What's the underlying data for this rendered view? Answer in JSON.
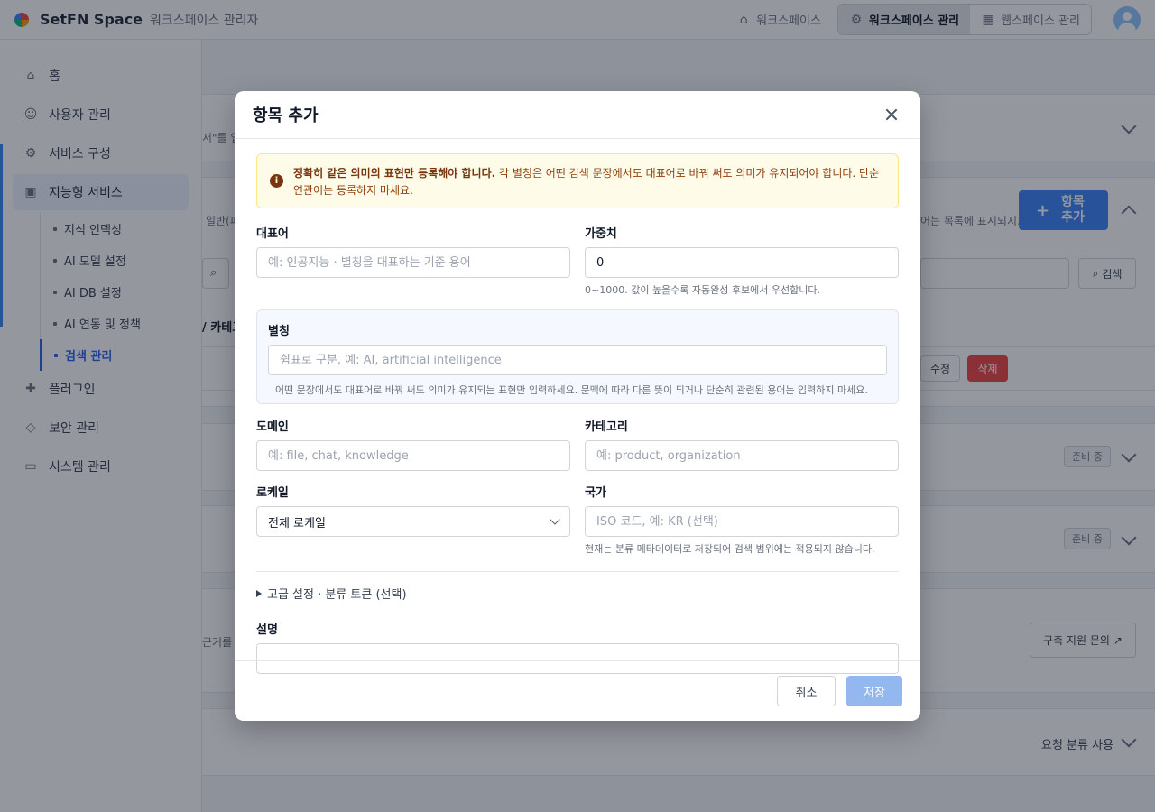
{
  "header": {
    "brand": "SetFN Space",
    "subtitle": "워크스페이스 관리자",
    "nav_workspace": "워크스페이스",
    "nav_workspace_admin": "워크스페이스 관리",
    "nav_webspace_admin": "웹스페이스 관리"
  },
  "sidebar": {
    "items": [
      {
        "label": "홈",
        "icon": "home-icon"
      },
      {
        "label": "사용자 관리",
        "icon": "users-icon"
      },
      {
        "label": "서비스 구성",
        "icon": "gear-icon"
      },
      {
        "label": "지능형 서비스",
        "icon": "chip-icon"
      },
      {
        "label": "플러그인",
        "icon": "puzzle-icon"
      },
      {
        "label": "보안 관리",
        "icon": "shield-icon"
      },
      {
        "label": "시스템 관리",
        "icon": "monitor-icon"
      }
    ],
    "sub_items": [
      {
        "label": "지식 인덱싱"
      },
      {
        "label": "AI 모델 설정"
      },
      {
        "label": "AI DB 설정"
      },
      {
        "label": "AI 연동 및 정책"
      },
      {
        "label": "검색 관리"
      }
    ]
  },
  "background": {
    "text1": "서\"를 입",
    "text2": "일반(파",
    "text3": "어는 목록에 표시되지...",
    "add_item_button": "항목 추가",
    "search_button": "검색",
    "category_text": "/ 카테고",
    "edit_button": "수정",
    "delete_button": "삭제",
    "badge_pending": "준비 중",
    "text4": "근거를 찾",
    "support_button": "구축 지원 문의",
    "request_text": "요청 분류 사용"
  },
  "modal": {
    "title": "항목 추가",
    "warning_bold": "정확히 같은 의미의 표현만 등록해야 합니다.",
    "warning_text": " 각 별칭은 어떤 검색 문장에서도 대표어로 바꿔 써도 의미가 유지되어야 합니다. 단순 연관어는 등록하지 마세요.",
    "rep_label": "대표어",
    "rep_placeholder": "예: 인공지능 · 별칭을 대표하는 기준 용어",
    "weight_label": "가중치",
    "weight_value": "0",
    "weight_hint": "0~1000. 값이 높을수록 자동완성 후보에서 우선합니다.",
    "alias_label": "별칭",
    "alias_placeholder": "쉼표로 구분, 예: AI, artificial intelligence",
    "alias_hint": "어떤 문장에서도 대표어로 바꿔 써도 의미가 유지되는 표현만 입력하세요. 문맥에 따라 다른 뜻이 되거나 단순히 관련된 용어는 입력하지 마세요.",
    "domain_label": "도메인",
    "domain_placeholder": "예: file, chat, knowledge",
    "category_label": "카테고리",
    "category_placeholder": "예: product, organization",
    "locale_label": "로케일",
    "locale_value": "전체 로케일",
    "country_label": "국가",
    "country_placeholder": "ISO 코드, 예: KR (선택)",
    "country_hint": "현재는 분류 메타데이터로 저장되어 검색 범위에는 적용되지 않습니다.",
    "advanced_label": "고급 설정 · 분류 토큰 (선택)",
    "desc_label": "설명",
    "desc_placeholder": "",
    "cancel_label": "취소",
    "save_label": "저장"
  },
  "colors": {
    "accent": "#3b82f6",
    "warning_bg": "#fefce8",
    "danger": "#ef4444",
    "save_disabled": "#93b7ef"
  }
}
